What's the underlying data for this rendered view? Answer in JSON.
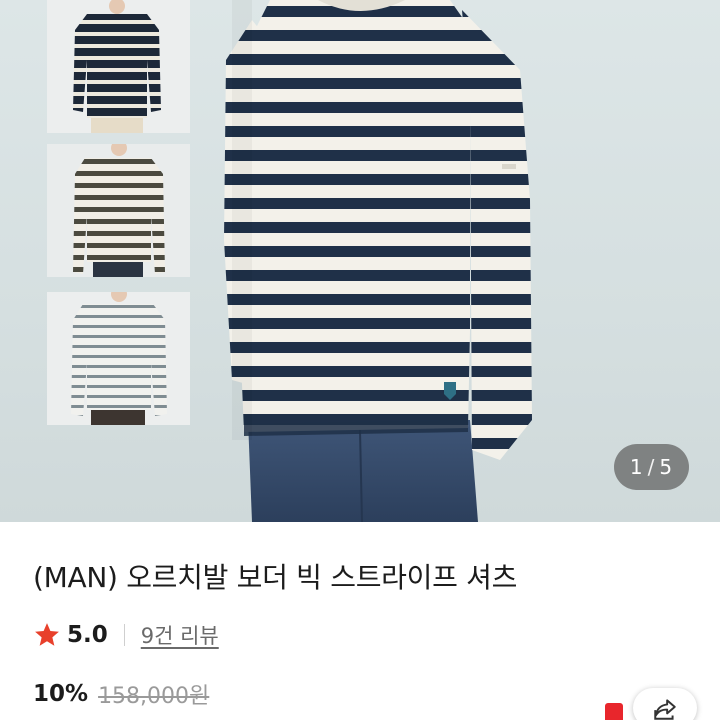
{
  "product": {
    "title": "(MAN) 오르치발 보더 빅 스트라이프 셔츠",
    "rating": "5.0",
    "review_link": "9건 리뷰",
    "discount": "10%",
    "original_price": "158,000원"
  },
  "gallery": {
    "current": "1",
    "separator": "/",
    "total": "5"
  },
  "icons": {
    "rating": "star-icon",
    "share": "share-icon"
  },
  "colors": {
    "star": "#e8402b",
    "accent_red": "#e8262c",
    "stripe_navy": "#1f3048",
    "stripe_cream": "#f3f1ea"
  }
}
